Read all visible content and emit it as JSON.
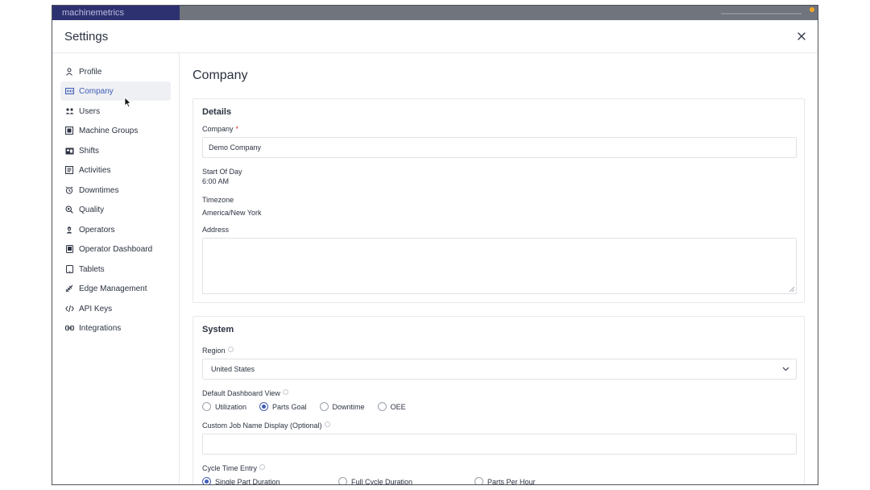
{
  "background": {
    "logo_text": "machinemetrics",
    "partial_title": "Company Dashboard"
  },
  "modal": {
    "title": "Settings",
    "close_icon": "close-icon"
  },
  "sidebar": {
    "items": [
      {
        "label": "Profile",
        "icon": "person-icon"
      },
      {
        "label": "Company",
        "icon": "company-icon",
        "active": true
      },
      {
        "label": "Users",
        "icon": "users-icon"
      },
      {
        "label": "Machine Groups",
        "icon": "machine-groups-icon"
      },
      {
        "label": "Shifts",
        "icon": "shifts-icon"
      },
      {
        "label": "Activities",
        "icon": "activities-icon"
      },
      {
        "label": "Downtimes",
        "icon": "alarm-clock-icon"
      },
      {
        "label": "Quality",
        "icon": "magnifier-icon"
      },
      {
        "label": "Operators",
        "icon": "operator-icon"
      },
      {
        "label": "Operator Dashboard",
        "icon": "tablet-icon"
      },
      {
        "label": "Tablets",
        "icon": "tablets-icon"
      },
      {
        "label": "Edge Management",
        "icon": "edge-icon"
      },
      {
        "label": "API Keys",
        "icon": "code-icon"
      },
      {
        "label": "Integrations",
        "icon": "integrations-icon"
      }
    ]
  },
  "main": {
    "page_title": "Company",
    "details": {
      "title": "Details",
      "company_label": "Company",
      "required_mark": "*",
      "company_value": "Demo Company",
      "start_of_day_label": "Start Of Day",
      "start_of_day_value": "6:00 AM",
      "timezone_label": "Timezone",
      "timezone_value": "America/New York",
      "address_label": "Address",
      "address_value": ""
    },
    "system": {
      "title": "System",
      "region_label": "Region",
      "region_value": "United States",
      "dashboard_view_label": "Default Dashboard View",
      "dashboard_options": [
        "Utilization",
        "Parts Goal",
        "Downtime",
        "OEE"
      ],
      "dashboard_selected": "Parts Goal",
      "custom_job_label": "Custom Job Name Display (Optional)",
      "custom_job_value": "",
      "cycle_time_label": "Cycle Time Entry",
      "cycle_options": [
        "Single Part Duration",
        "Full Cycle Duration",
        "Parts Per Hour"
      ],
      "cycle_selected": "Single Part Duration"
    }
  },
  "colors": {
    "accent": "#3f5bb5",
    "required": "#d0322d",
    "active_bg": "#eef0f4"
  }
}
